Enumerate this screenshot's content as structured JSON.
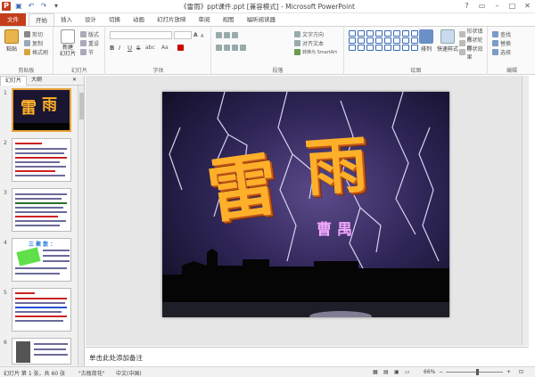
{
  "window": {
    "title": "《雷雨》ppt课件.ppt [兼容模式] - Microsoft PowerPoint"
  },
  "tabs": [
    "文件",
    "开始",
    "插入",
    "设计",
    "切换",
    "动画",
    "幻灯片放映",
    "审阅",
    "视图",
    "福昕阅读器"
  ],
  "ribbon": {
    "clipboard": {
      "paste": "粘贴",
      "cut": "剪切",
      "copy": "复制",
      "format_painter": "格式刷",
      "label": "剪贴板"
    },
    "slides": {
      "new_slide": "新建\n幻灯片",
      "layout": "版式",
      "reset": "重设",
      "section": "节",
      "label": "幻灯片"
    },
    "font": {
      "label": "字体",
      "bold": "B",
      "italic": "I",
      "underline": "U",
      "strike": "S",
      "shadow": "abc",
      "grow": "A",
      "shrink": "A",
      "clear": "Aa"
    },
    "paragraph": {
      "label": "段落",
      "text_direction": "文字方向",
      "align_text": "对齐文本",
      "smartart": "转换为 SmartArt"
    },
    "drawing": {
      "label": "绘图",
      "arrange": "排列",
      "quick_styles": "快速样式",
      "fill": "形状填充",
      "outline": "形状轮廓",
      "effects": "形状效果"
    },
    "editing": {
      "label": "编辑",
      "find": "查找",
      "replace": "替换",
      "select": "选择"
    }
  },
  "left_panel": {
    "tabs": [
      "幻灯片",
      "大纲"
    ],
    "slide_numbers": [
      "1",
      "2",
      "3",
      "4",
      "5",
      "6"
    ],
    "slide4_heading": "三 聚 散 ："
  },
  "slide": {
    "title_chars": [
      "雷",
      "雨"
    ],
    "subtitle": "曹禺"
  },
  "notes_placeholder": "单击此处添加备注",
  "status": {
    "slide_info": "幻灯片 第 1 张，共 60 张",
    "theme": "\"古瓶荷花\"",
    "language": "中文(中国)",
    "zoom": "66%",
    "zoom_fraction": 0.55
  }
}
